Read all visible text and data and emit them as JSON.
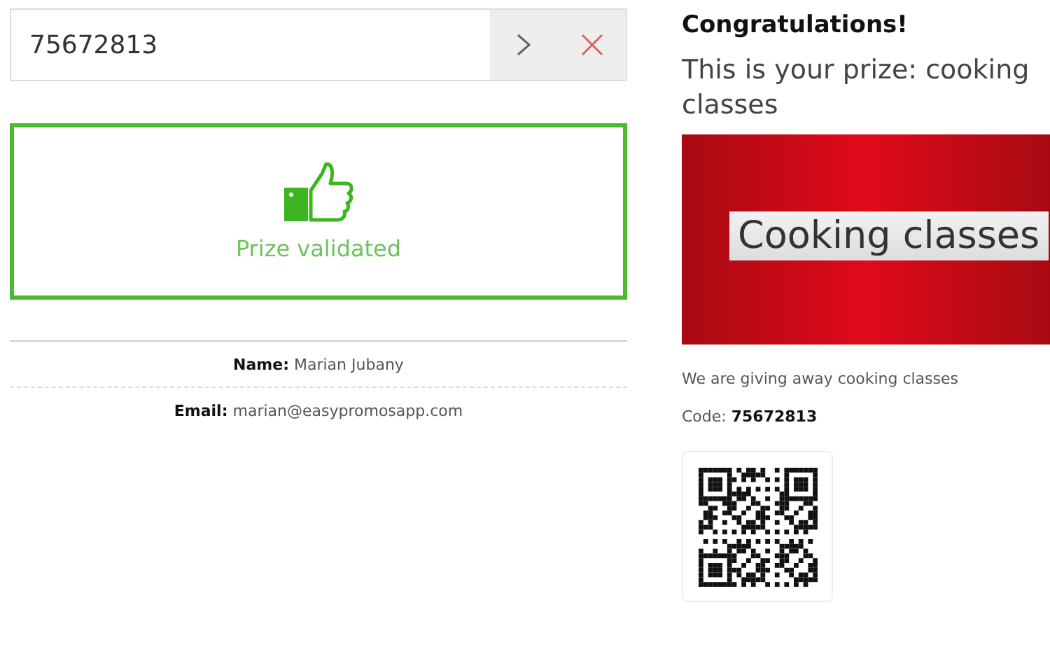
{
  "code_field": {
    "value": "75672813"
  },
  "validation": {
    "validated": true,
    "message": "Prize validated"
  },
  "details": [
    {
      "label": "Name:",
      "value": "Marian Jubany"
    },
    {
      "label": "Email:",
      "value": "marian@easypromosapp.com"
    }
  ],
  "prize": {
    "heading": "Congratulations!",
    "title": "This is your prize: cooking classes",
    "banner_text": "Cooking classes",
    "description": "We are giving away cooking classes",
    "code_label": "Code:",
    "code": "75672813"
  }
}
